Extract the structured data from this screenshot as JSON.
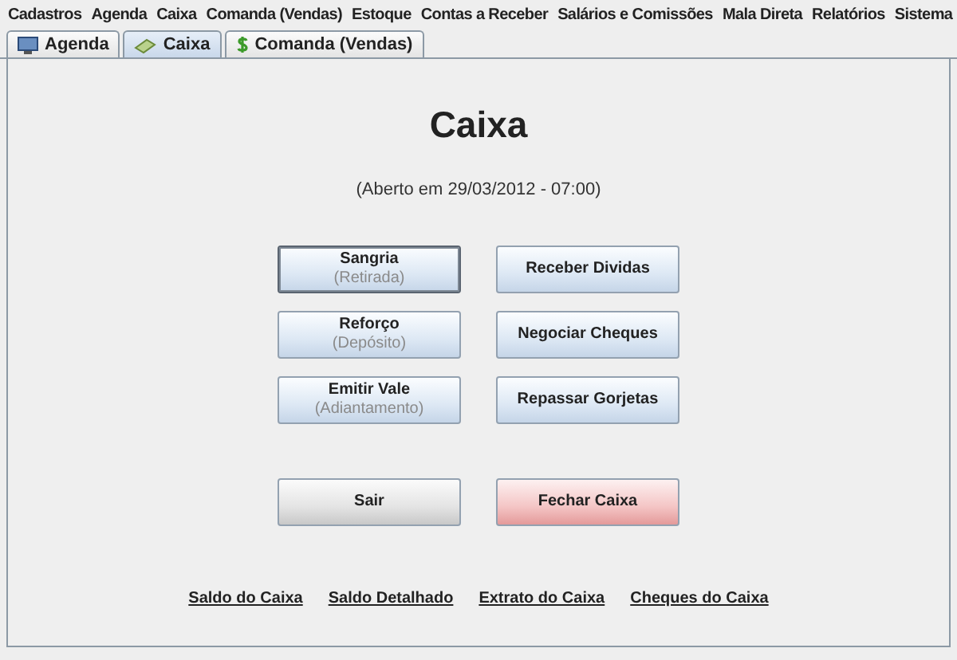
{
  "menu": [
    "Cadastros",
    "Agenda",
    "Caixa",
    "Comanda (Vendas)",
    "Estoque",
    "Contas a Receber",
    "Salários e Comissões",
    "Mala Direta",
    "Relatórios",
    "Sistema"
  ],
  "tabs": [
    {
      "label": "Agenda",
      "kind": "monitor",
      "selected": false
    },
    {
      "label": "Caixa",
      "kind": "cash",
      "selected": true
    },
    {
      "label": "Comanda (Vendas)",
      "kind": "dollar",
      "selected": false
    }
  ],
  "title": "Caixa",
  "subtitle": "(Aberto em 29/03/2012 - 07:00)",
  "actions": [
    {
      "label": "Sangria",
      "sub": "(Retirada)",
      "focused": true
    },
    {
      "label": "Receber Dividas",
      "focused": false
    },
    {
      "label": "Reforço",
      "sub": "(Depósito)",
      "focused": false
    },
    {
      "label": "Negociar Cheques",
      "focused": false
    },
    {
      "label": "Emitir Vale",
      "sub": "(Adiantamento)",
      "focused": false
    },
    {
      "label": "Repassar Gorjetas",
      "focused": false
    }
  ],
  "bottom_buttons": [
    {
      "label": "Sair",
      "kind": "neutral"
    },
    {
      "label": "Fechar Caixa",
      "kind": "danger"
    }
  ],
  "links": [
    "Saldo do Caixa",
    "Saldo Detalhado",
    "Extrato do Caixa",
    "Cheques do Caixa"
  ]
}
